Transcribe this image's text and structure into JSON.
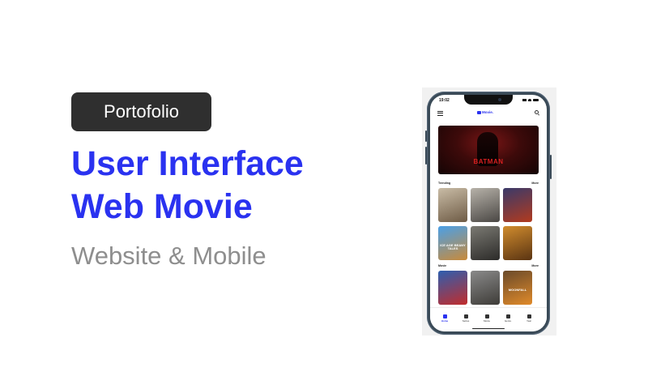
{
  "badge": "Portofolio",
  "title": {
    "line1": "User Interface",
    "line2": "Web Movie"
  },
  "subtitle": "Website & Mobile",
  "phone": {
    "status_time": "19:02",
    "logo": "Movie.",
    "hero_title": "BATMAN",
    "sections": [
      {
        "title": "Trending",
        "more": "More",
        "posters": [
          {
            "label": "",
            "colors": [
              "#c9bca6",
              "#6e5b45"
            ]
          },
          {
            "label": "",
            "colors": [
              "#b7b2a9",
              "#4a4744"
            ]
          },
          {
            "label": "",
            "colors": [
              "#3a3a6a",
              "#b23a1e"
            ]
          },
          {
            "label": "ICE AGE BEANY TALES",
            "colors": [
              "#4aa0e8",
              "#c98a3a"
            ]
          },
          {
            "label": "",
            "colors": [
              "#7b7a73",
              "#2c2b29"
            ]
          },
          {
            "label": "",
            "colors": [
              "#d18c2e",
              "#5a3412"
            ]
          }
        ]
      },
      {
        "title": "Movie",
        "more": "More",
        "posters": [
          {
            "label": "",
            "colors": [
              "#2d5fb0",
              "#c22c2c"
            ]
          },
          {
            "label": "",
            "colors": [
              "#8a8a8a",
              "#3e3c38"
            ]
          },
          {
            "label": "MOONFALL",
            "colors": [
              "#6a4a2a",
              "#e08a2a"
            ]
          }
        ]
      }
    ],
    "tabs": [
      {
        "label": "Home",
        "icon": "home-icon",
        "active": true
      },
      {
        "label": "Series",
        "icon": "series-icon",
        "active": false
      },
      {
        "label": "Movie",
        "icon": "movie-icon",
        "active": false
      },
      {
        "label": "Genre",
        "icon": "grid-icon",
        "active": false
      },
      {
        "label": "Year",
        "icon": "layers-icon",
        "active": false
      }
    ]
  }
}
